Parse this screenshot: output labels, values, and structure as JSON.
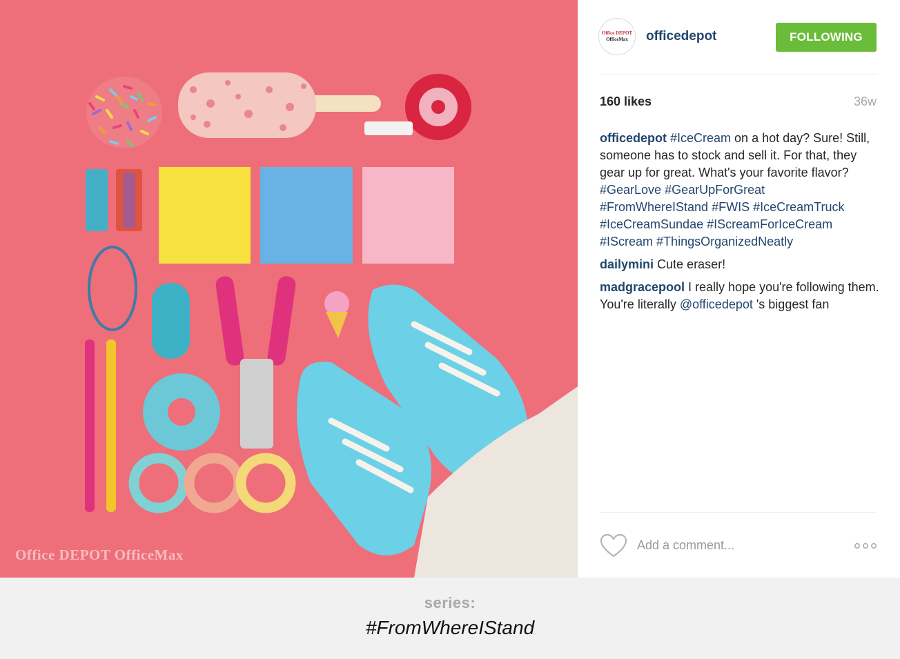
{
  "post": {
    "image_watermark": "Office DEPOT OfficeMax",
    "header": {
      "avatar_line1": "Office DEPOT",
      "avatar_line2": "OfficeMax",
      "username": "officedepot",
      "follow_label": "FOLLOWING"
    },
    "likes": "160 likes",
    "age": "36w",
    "caption": {
      "username": "officedepot",
      "hashtag_first": "#IceCream",
      "text": " on a hot day? Sure! Still, someone has to stock and sell it. For that, they gear up for great. What's your favorite flavor?",
      "hashtags": [
        "#GearLove",
        "#GearUpForGreat",
        "#FromWhereIStand",
        "#FWIS",
        "#IceCreamTruck",
        "#IceCreamSundae",
        "#IScreamForIceCream",
        "#IScream",
        "#ThingsOrganizedNeatly"
      ]
    },
    "comments": [
      {
        "username": "dailymini",
        "text": " Cute eraser!"
      },
      {
        "username": "madgracepool",
        "text": " I really hope you're following them. You're literally ",
        "mention": "@officedepot",
        "text_after": " 's biggest fan"
      }
    ],
    "comment_placeholder": "Add a comment...",
    "icons": {
      "like": "heart-icon",
      "more": "more-options-icon"
    },
    "colors": {
      "accent": "#6bbc3a",
      "link": "#23466e",
      "photo_bg": "#ee6e79"
    }
  },
  "series": {
    "label": "series:",
    "name": "#FromWhereIStand"
  }
}
